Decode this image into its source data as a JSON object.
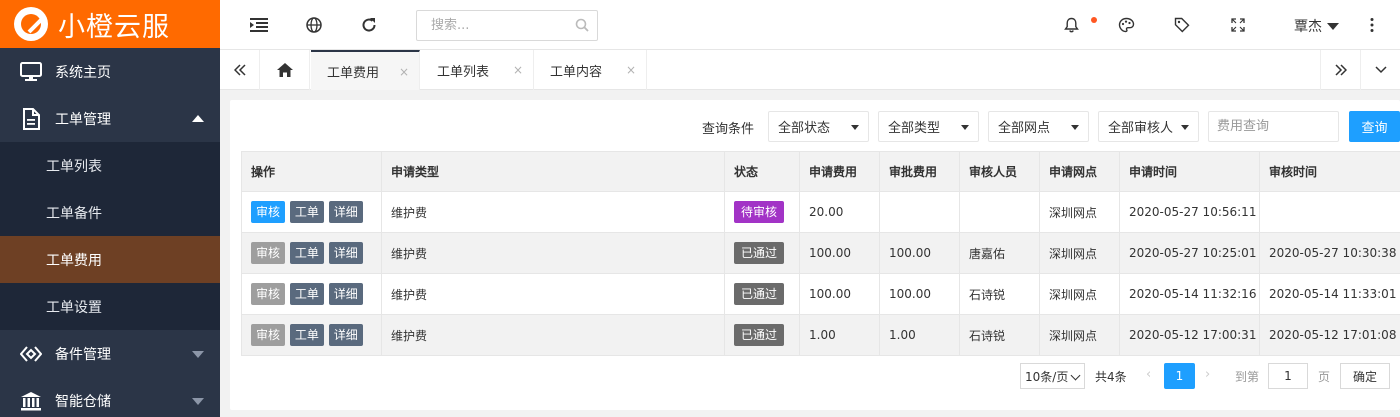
{
  "app": {
    "logo_text": "小橙云服",
    "brand_color": "#ff6a00"
  },
  "sidebar": {
    "items": [
      {
        "label": "系统主页",
        "icon": "monitor-icon"
      },
      {
        "label": "工单管理",
        "icon": "document-icon",
        "expanded": true,
        "children": [
          {
            "label": "工单列表"
          },
          {
            "label": "工单备件"
          },
          {
            "label": "工单费用",
            "active": true
          },
          {
            "label": "工单设置"
          }
        ]
      },
      {
        "label": "备件管理",
        "icon": "parts-icon"
      },
      {
        "label": "智能仓储",
        "icon": "warehouse-icon"
      }
    ]
  },
  "header": {
    "search_placeholder": "搜索...",
    "user_name": "覃杰",
    "icons": [
      "menu-toggle-icon",
      "globe-icon",
      "refresh-icon",
      "search-icon",
      "bell-icon",
      "palette-icon",
      "tag-icon",
      "fullscreen-icon",
      "more-icon"
    ]
  },
  "tabs": [
    {
      "label": "工单费用",
      "active": true,
      "close": "×"
    },
    {
      "label": "工单列表",
      "close": "×"
    },
    {
      "label": "工单内容",
      "close": "×"
    }
  ],
  "filters": {
    "label": "查询条件",
    "status": "全部状态",
    "type": "全部类型",
    "outlet": "全部网点",
    "reviewer": "全部审核人",
    "fee_placeholder": "费用查询",
    "query_button": "查询"
  },
  "table": {
    "headers": [
      "操作",
      "申请类型",
      "状态",
      "申请费用",
      "审批费用",
      "审核人员",
      "申请网点",
      "申请时间",
      "审核时间"
    ],
    "ops": {
      "audit": "审核",
      "order": "工单",
      "detail": "详细"
    },
    "rows": [
      {
        "type": "维护费",
        "status": "待审核",
        "apply_fee": "20.00",
        "approve_fee": "",
        "reviewer": "",
        "outlet": "深圳网点",
        "apply_time": "2020-05-27 10:56:11",
        "review_time": ""
      },
      {
        "type": "维护费",
        "status": "已通过",
        "apply_fee": "100.00",
        "approve_fee": "100.00",
        "reviewer": "唐嘉佑",
        "outlet": "深圳网点",
        "apply_time": "2020-05-27 10:25:01",
        "review_time": "2020-05-27 10:30:38"
      },
      {
        "type": "维护费",
        "status": "已通过",
        "apply_fee": "100.00",
        "approve_fee": "100.00",
        "reviewer": "石诗锐",
        "outlet": "深圳网点",
        "apply_time": "2020-05-14 11:32:16",
        "review_time": "2020-05-14 11:33:01"
      },
      {
        "type": "维护费",
        "status": "已通过",
        "apply_fee": "1.00",
        "approve_fee": "1.00",
        "reviewer": "石诗锐",
        "outlet": "深圳网点",
        "apply_time": "2020-05-12 17:00:31",
        "review_time": "2020-05-12 17:01:08"
      }
    ]
  },
  "pagination": {
    "page_size": "10条/页",
    "total": "共4条",
    "prev": "‹",
    "next": "›",
    "current_page": "1",
    "goto_label": "到第",
    "goto_value": "1",
    "page_label": "页",
    "confirm": "确定"
  },
  "colors": {
    "primary": "#1e9fff",
    "pending": "#a233c6",
    "passed": "#6b6b6b",
    "sidebar_bg": "#2b3547",
    "sidebar_active": "#6e4024"
  }
}
